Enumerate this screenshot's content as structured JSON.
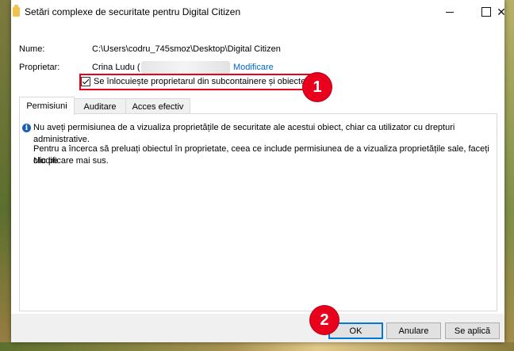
{
  "window": {
    "title": "Setări complexe de securitate pentru Digital Citizen",
    "minimize_symbol": "—",
    "close_symbol": "✕"
  },
  "fields": {
    "name_label": "Nume:",
    "name_value": "C:\\Users\\codru_745smoz\\Desktop\\Digital Citizen",
    "owner_label": "Proprietar:",
    "owner_value": "Crina Ludu (",
    "change_link": "Modificare",
    "replace_owner_checkbox": "Se înlocuiește proprietarul din subcontainere și obiecte",
    "replace_owner_checked": true
  },
  "tabs": [
    {
      "label": "Permisiuni",
      "active": true
    },
    {
      "label": "Auditare",
      "active": false
    },
    {
      "label": "Acces efectiv",
      "active": false
    }
  ],
  "panel": {
    "info_symbol": "i",
    "message1": "Nu aveți permisiunea de a vizualiza proprietățile de securitate ale acestui obiect, chiar ca utilizator cu drepturi administrative.",
    "message2_line1": "Pentru a încerca să preluați obiectul în proprietate, ceea ce include permisiunea de a vizualiza proprietățile sale, faceți clic pe",
    "message2_line2": "Modificare mai sus."
  },
  "buttons": {
    "ok": "OK",
    "cancel": "Anulare",
    "apply": "Se aplică"
  },
  "annotations": {
    "badge1": "1",
    "badge2": "2",
    "color": "#e8001c"
  },
  "icons": [
    "folder-icon",
    "minimize-icon",
    "maximize-icon",
    "close-icon",
    "info-icon",
    "checkmark-icon"
  ]
}
